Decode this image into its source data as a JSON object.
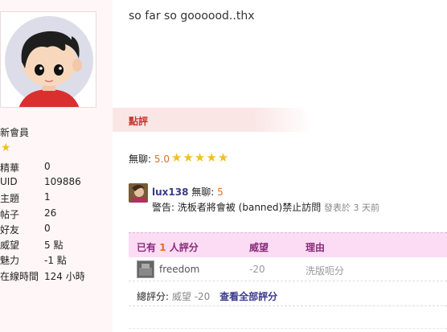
{
  "sidebar": {
    "user_title": "新會員",
    "stats": [
      {
        "label": "精華",
        "value": "0"
      },
      {
        "label": "UID",
        "value": "109886"
      },
      {
        "label": "主題",
        "value": "1"
      },
      {
        "label": "帖子",
        "value": "26"
      },
      {
        "label": "好友",
        "value": "0"
      },
      {
        "label": "威望",
        "value": "5 點"
      },
      {
        "label": "魅力",
        "value": "-1 點"
      },
      {
        "label": "在線時間",
        "value": "124 小時"
      }
    ]
  },
  "post": {
    "text": "so far so goooood..thx"
  },
  "rating": {
    "header": "點評",
    "boring_label": "無聊:",
    "boring_value": "5.0",
    "comment": {
      "user": "lux138",
      "score_label": "無聊:",
      "score": "5",
      "warning": "警告: 洗板者將會被 (banned)禁止訪問",
      "posted": "發表於 3 天前"
    }
  },
  "ratings_table": {
    "header_prefix": "已有",
    "header_count": "1",
    "header_suffix": "人評分",
    "col_prestige": "威望",
    "col_reason": "理由",
    "rows": [
      {
        "user": "freedom",
        "prestige": "-20",
        "reason": "洗版呃分"
      }
    ],
    "total_label": "總評分:",
    "total_value": "威望 -20",
    "view_all": "查看全部評分"
  },
  "colors": {
    "accent_red": "#c0392b",
    "accent_orange": "#e07020",
    "link": "#3a3a8c",
    "table_header_bg": "#fbdcf4"
  }
}
